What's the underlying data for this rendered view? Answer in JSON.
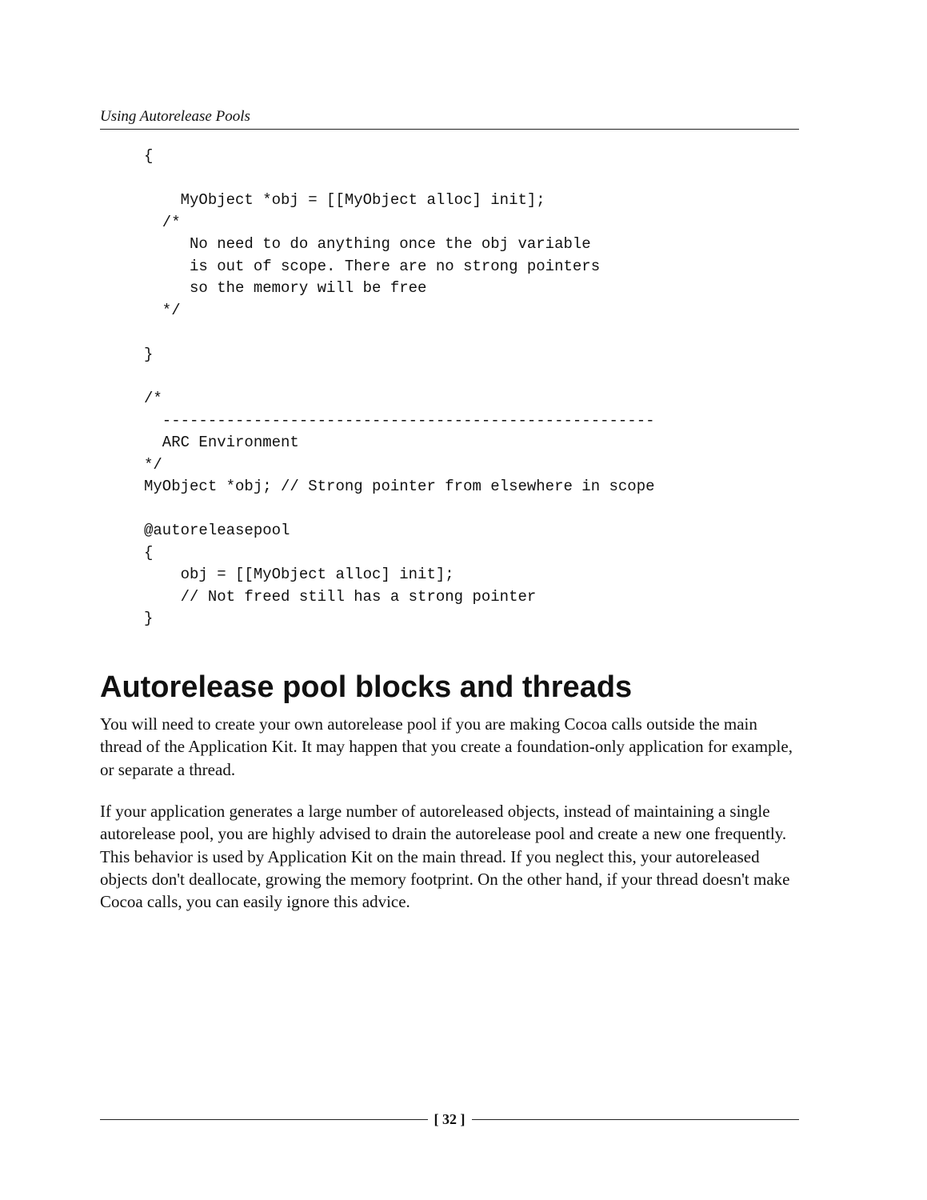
{
  "header": {
    "running_title": "Using Autorelease Pools"
  },
  "code": {
    "lines": [
      "{",
      "",
      "    MyObject *obj = [[MyObject alloc] init];",
      "  /*",
      "     No need to do anything once the obj variable",
      "     is out of scope. There are no strong pointers",
      "     so the memory will be free",
      "  */",
      "",
      "}",
      "",
      "/*",
      "  ------------------------------------------------------",
      "  ARC Environment",
      "*/",
      "MyObject *obj; // Strong pointer from elsewhere in scope",
      "",
      "@autoreleasepool",
      "{",
      "    obj = [[MyObject alloc] init];",
      "    // Not freed still has a strong pointer",
      "}"
    ]
  },
  "section": {
    "heading": "Autorelease pool blocks and threads",
    "para1": "You will need to create your own autorelease pool if you are making Cocoa calls outside the main thread of the Application Kit. It may happen that you create a foundation-only application for example, or separate a thread.",
    "para2": "If your application generates a large number of autoreleased objects, instead of maintaining a single autorelease pool, you are highly advised to drain the autorelease pool and create a new one frequently. This behavior is used by Application Kit on the main thread. If you neglect this, your autoreleased objects don't deallocate, growing the memory footprint. On the other hand, if your thread doesn't make Cocoa calls, you can easily ignore this advice."
  },
  "footer": {
    "page_number": "[ 32 ]"
  }
}
